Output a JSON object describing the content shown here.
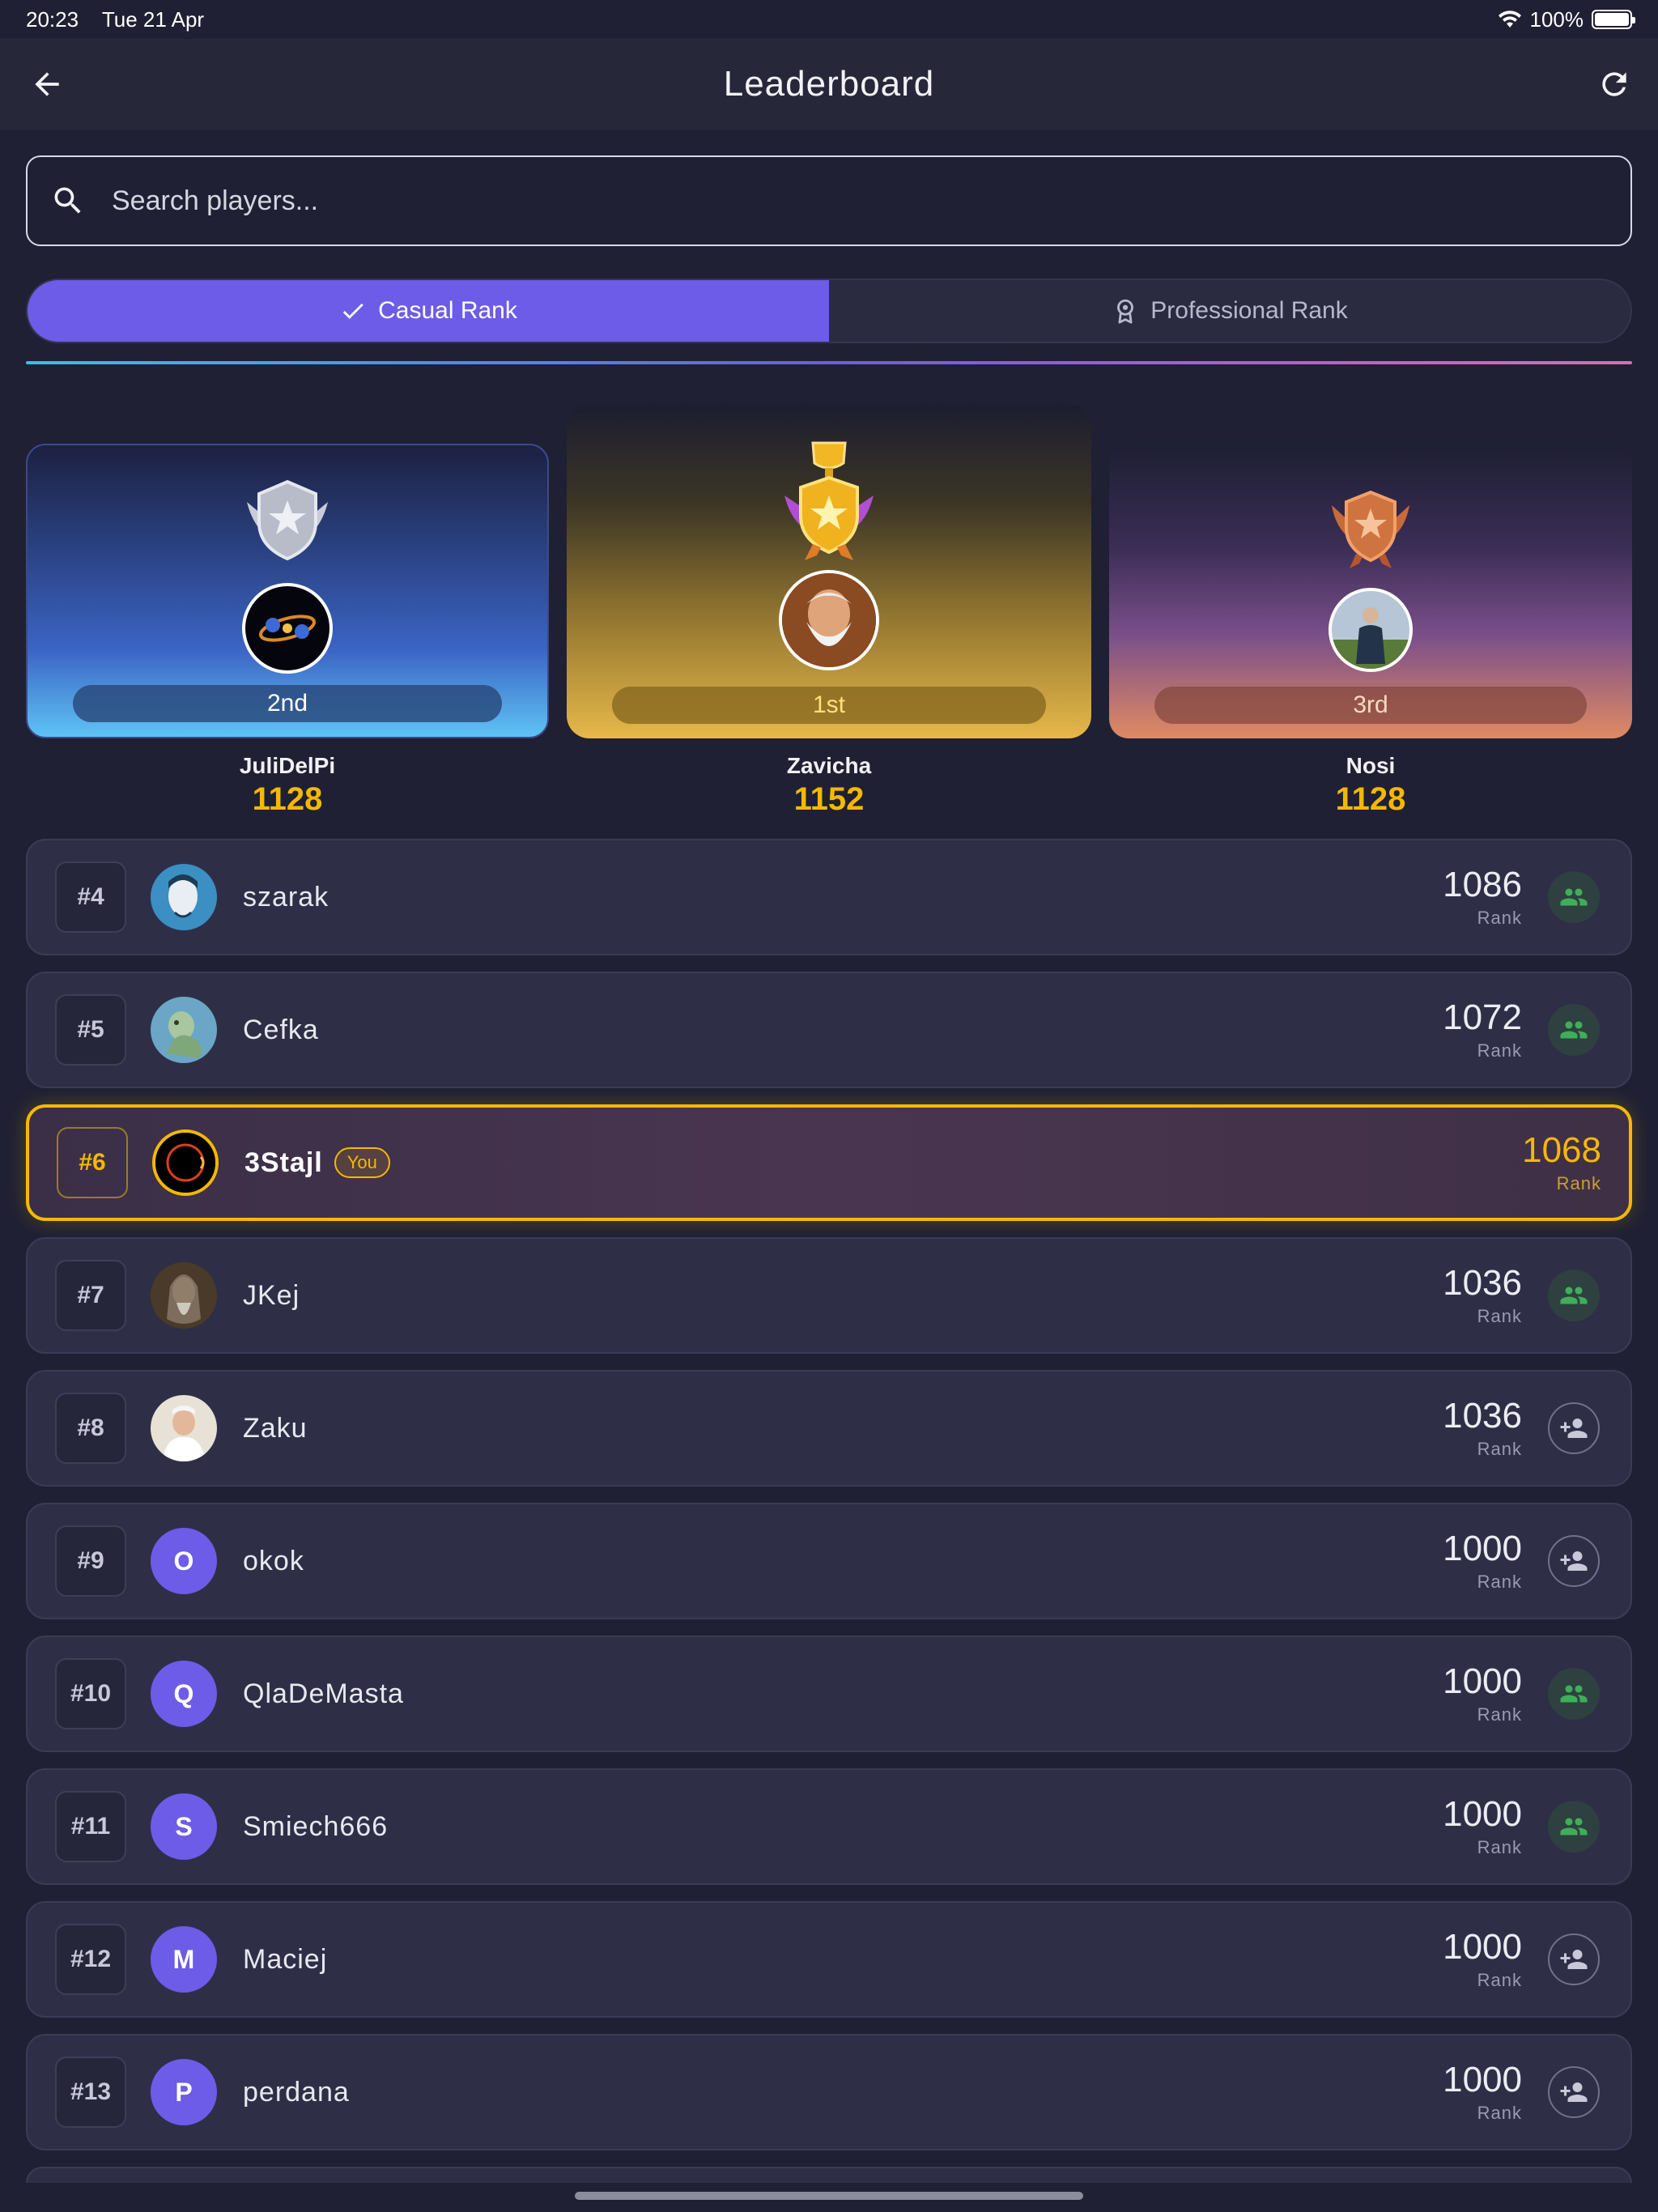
{
  "status_bar": {
    "time": "20:23",
    "date": "Tue 21 Apr",
    "battery": "100%"
  },
  "header": {
    "title": "Leaderboard"
  },
  "search": {
    "placeholder": "Search players..."
  },
  "tabs": [
    {
      "label": "Casual Rank",
      "active": true
    },
    {
      "label": "Professional Rank",
      "active": false
    }
  ],
  "podium": {
    "second": {
      "place": "2nd",
      "name": "JuliDelPi",
      "score": "1128"
    },
    "first": {
      "place": "1st",
      "name": "Zavicha",
      "score": "1152"
    },
    "third": {
      "place": "3rd",
      "name": "Nosi",
      "score": "1128"
    }
  },
  "rank_label": "Rank",
  "you_label": "You",
  "players": [
    {
      "rank": "#4",
      "name": "szarak",
      "score": "1086",
      "avatar": "photo",
      "action": "friend"
    },
    {
      "rank": "#5",
      "name": "Cefka",
      "score": "1072",
      "avatar": "photo",
      "action": "friend"
    },
    {
      "rank": "#6",
      "name": "3Stajl",
      "score": "1068",
      "avatar": "photo",
      "action": "none",
      "me": true
    },
    {
      "rank": "#7",
      "name": "JKej",
      "score": "1036",
      "avatar": "photo",
      "action": "friend"
    },
    {
      "rank": "#8",
      "name": "Zaku",
      "score": "1036",
      "avatar": "photo",
      "action": "add"
    },
    {
      "rank": "#9",
      "name": "okok",
      "score": "1000",
      "avatar": "O",
      "action": "add"
    },
    {
      "rank": "#10",
      "name": "QlaDeMasta",
      "score": "1000",
      "avatar": "Q",
      "action": "friend"
    },
    {
      "rank": "#11",
      "name": "Smiech666",
      "score": "1000",
      "avatar": "S",
      "action": "friend"
    },
    {
      "rank": "#12",
      "name": "Maciej",
      "score": "1000",
      "avatar": "M",
      "action": "add"
    },
    {
      "rank": "#13",
      "name": "perdana",
      "score": "1000",
      "avatar": "P",
      "action": "add"
    }
  ],
  "colors": {
    "accent": "#6c5ce7",
    "gold": "#f5b800",
    "friend_green": "#3fae5a"
  },
  "icons": {
    "back": "arrow-left-icon",
    "refresh": "refresh-icon",
    "search": "search-icon",
    "check": "check-icon",
    "award": "award-icon",
    "friends": "people-icon",
    "add_friend": "person-add-icon"
  }
}
